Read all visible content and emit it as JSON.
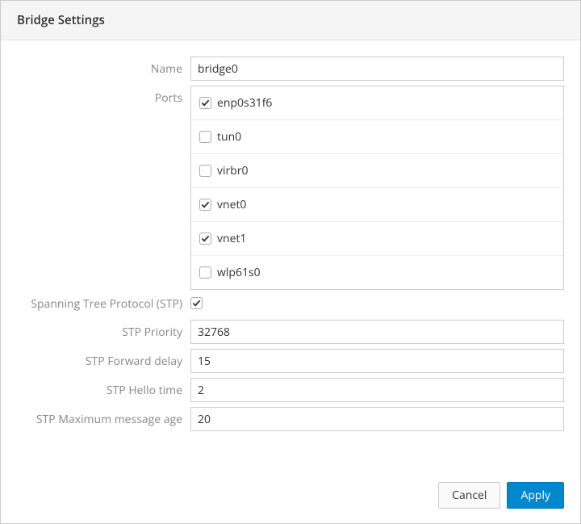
{
  "header": {
    "title": "Bridge Settings"
  },
  "form": {
    "name": {
      "label": "Name",
      "value": "bridge0"
    },
    "ports": {
      "label": "Ports",
      "items": [
        {
          "label": "enp0s31f6",
          "checked": true
        },
        {
          "label": "tun0",
          "checked": false
        },
        {
          "label": "virbr0",
          "checked": false
        },
        {
          "label": "vnet0",
          "checked": true
        },
        {
          "label": "vnet1",
          "checked": true
        },
        {
          "label": "wlp61s0",
          "checked": false
        }
      ]
    },
    "stp": {
      "label": "Spanning Tree Protocol (STP)",
      "checked": true
    },
    "stp_priority": {
      "label": "STP Priority",
      "value": "32768"
    },
    "stp_forward_delay": {
      "label": "STP Forward delay",
      "value": "15"
    },
    "stp_hello_time": {
      "label": "STP Hello time",
      "value": "2"
    },
    "stp_max_age": {
      "label": "STP Maximum message age",
      "value": "20"
    }
  },
  "footer": {
    "cancel": "Cancel",
    "apply": "Apply"
  }
}
